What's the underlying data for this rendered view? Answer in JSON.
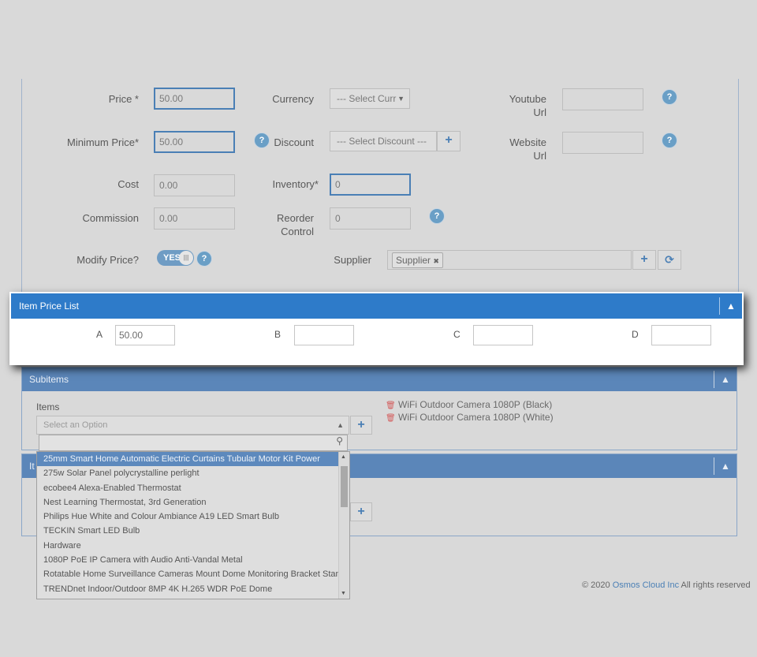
{
  "form": {
    "price": {
      "label": "Price *",
      "value": "50.00"
    },
    "minimum_price": {
      "label": "Minimum Price*",
      "value": "50.00"
    },
    "cost": {
      "label": "Cost",
      "value": "0.00"
    },
    "commission": {
      "label": "Commission",
      "value": "0.00"
    },
    "modify_price": {
      "label": "Modify Price?",
      "toggle_label": "YES",
      "knob_glyph": "|||"
    },
    "currency": {
      "label": "Currency",
      "placeholder": "--- Select Curr"
    },
    "discount": {
      "label": "Discount",
      "placeholder": "--- Select Discount ---"
    },
    "inventory": {
      "label": "Inventory*",
      "value": "0"
    },
    "reorder_control": {
      "label_line1": "Reorder",
      "label_line2": "Control",
      "value": "0"
    },
    "supplier": {
      "label": "Supplier",
      "tag": "Supplier",
      "tag_remove": "✖"
    },
    "youtube_url": {
      "label_line1": "Youtube",
      "label_line2": "Url",
      "value": ""
    },
    "website_url": {
      "label_line1": "Website",
      "label_line2": "Url",
      "value": ""
    },
    "help_glyph": "?",
    "plus_glyph": "+",
    "refresh_glyph": "⟳"
  },
  "item_price_list": {
    "title": "Item Price List",
    "chevron": "▲",
    "fields": [
      {
        "label": "A",
        "value": "50.00"
      },
      {
        "label": "B",
        "value": ""
      },
      {
        "label": "C",
        "value": ""
      },
      {
        "label": "D",
        "value": ""
      }
    ]
  },
  "subitems": {
    "title": "Subitems",
    "chevron": "▲",
    "items_label": "Items",
    "select_placeholder": "Select an Option",
    "selected": [
      "WiFi Outdoor Camera 1080P (Black)",
      "WiFi Outdoor Camera 1080P (White)"
    ],
    "options": [
      "25mm Smart Home Automatic Electric Curtains Tubular Motor Kit Power",
      "275w Solar Panel polycrystalline perlight",
      "ecobee4 Alexa-Enabled Thermostat",
      "Nest Learning Thermostat, 3rd Generation",
      "Philips Hue White and Colour Ambiance A19 LED Smart Bulb",
      "TECKIN Smart LED Bulb",
      "Hardware",
      "1080P PoE IP Camera with Audio Anti-Vandal Metal",
      "Rotatable Home Surveillance Cameras Mount Dome Monitoring Bracket Stands",
      "TRENDnet Indoor/Outdoor 8MP 4K H.265 WDR PoE Dome"
    ]
  },
  "third_panel": {
    "title_partial": "It",
    "chevron": "▲"
  },
  "footer": {
    "prefix": "© 2020 ",
    "company": "Osmos Cloud Inc",
    "suffix": " All rights reserved"
  },
  "colors": {
    "accent": "#2e7bc9",
    "panel_header_dim": "#5b86b9",
    "trash": "#d35c5c"
  }
}
